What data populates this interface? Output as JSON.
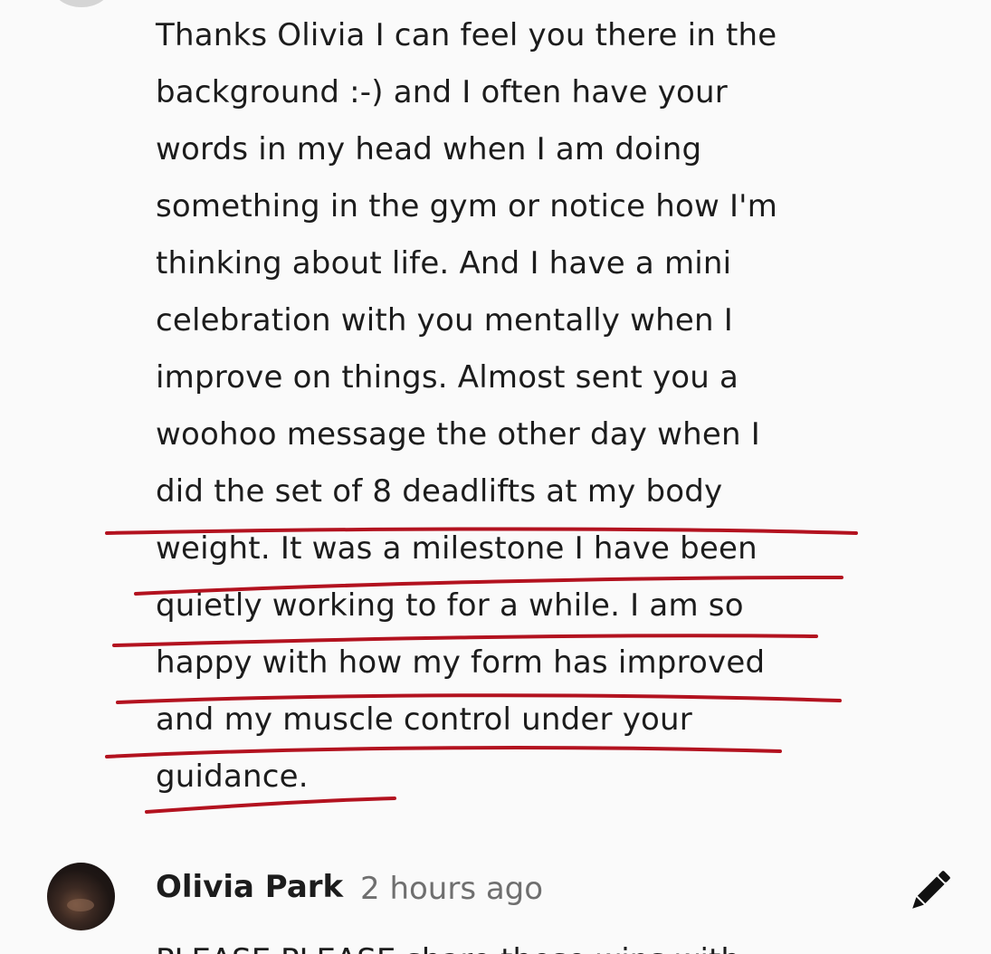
{
  "message": {
    "lines": [
      "Thanks Olivia I can feel you there in the",
      "background :-) and I often have your",
      "words in my head when I am doing",
      "something in the gym or notice how I'm",
      "thinking about life. And I have a mini",
      "celebration with you mentally when I",
      "improve on things. Almost sent you a",
      "woohoo message the other day when I",
      "did the set of 8 deadlifts at my body",
      "weight. It was a milestone I have been",
      "quietly working to for a while. I am so",
      "happy with how my form has improved",
      "and my muscle control under your",
      "guidance."
    ],
    "annotation_color": "#b3121f"
  },
  "comment": {
    "author": "Olivia Park",
    "timestamp": "2 hours ago",
    "edit_icon": "pencil-icon",
    "next_text_partial": "PLEASE PLEASE share these wins with"
  }
}
